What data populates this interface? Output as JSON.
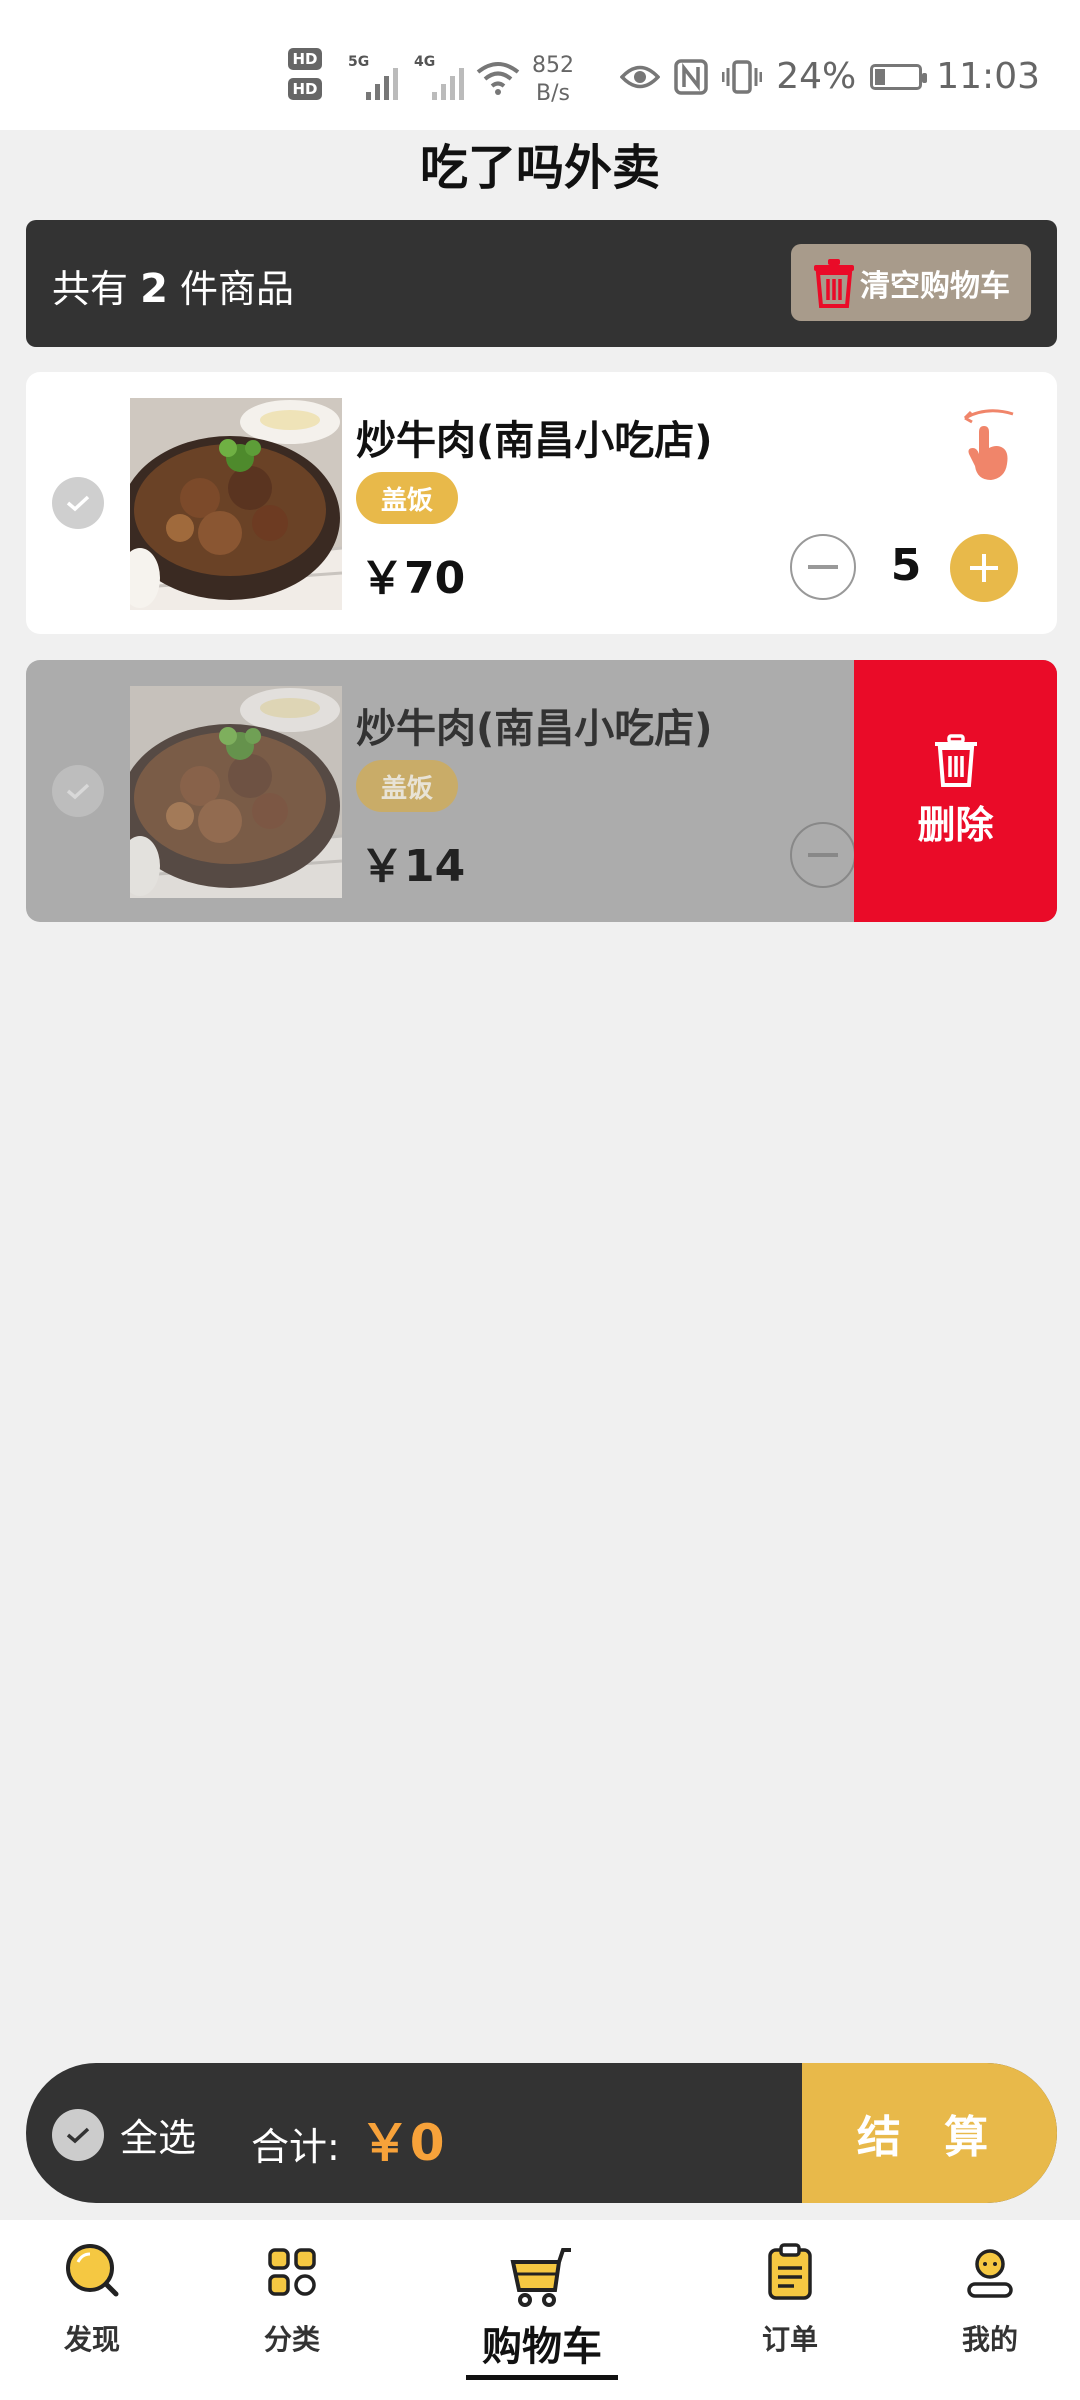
{
  "status_bar": {
    "network_5g": "5G",
    "network_4g": "4G",
    "hd1": "HD",
    "hd2": "HD",
    "speed_value": "852",
    "speed_unit": "B/s",
    "battery_percent": "24%",
    "time": "11:03"
  },
  "page": {
    "title": "吃了吗外卖"
  },
  "cart_header": {
    "count_prefix": "共有",
    "count": "2",
    "count_suffix": "件商品",
    "clear_label": "清空购物车"
  },
  "items": [
    {
      "name": "炒牛肉(南昌小吃店)",
      "tag": "盖饭",
      "price": "￥70",
      "quantity": "5",
      "selected": false
    },
    {
      "name": "炒牛肉(南昌小吃店)",
      "tag": "盖饭",
      "price": "￥14",
      "selected": false,
      "delete_label": "删除"
    }
  ],
  "checkout_bar": {
    "select_all": "全选",
    "total_label": "合计:",
    "total_value": "￥0",
    "checkout_label": "结 算"
  },
  "tab_bar": [
    {
      "label": "发现",
      "icon": "discover-icon"
    },
    {
      "label": "分类",
      "icon": "category-icon"
    },
    {
      "label": "购物车",
      "icon": "cart-icon",
      "active": true
    },
    {
      "label": "订单",
      "icon": "order-icon"
    },
    {
      "label": "我的",
      "icon": "profile-icon"
    }
  ],
  "colors": {
    "accent": "#e8b94a",
    "dark": "#333333",
    "danger": "#ea0b28",
    "price_total": "#f7a23a"
  }
}
